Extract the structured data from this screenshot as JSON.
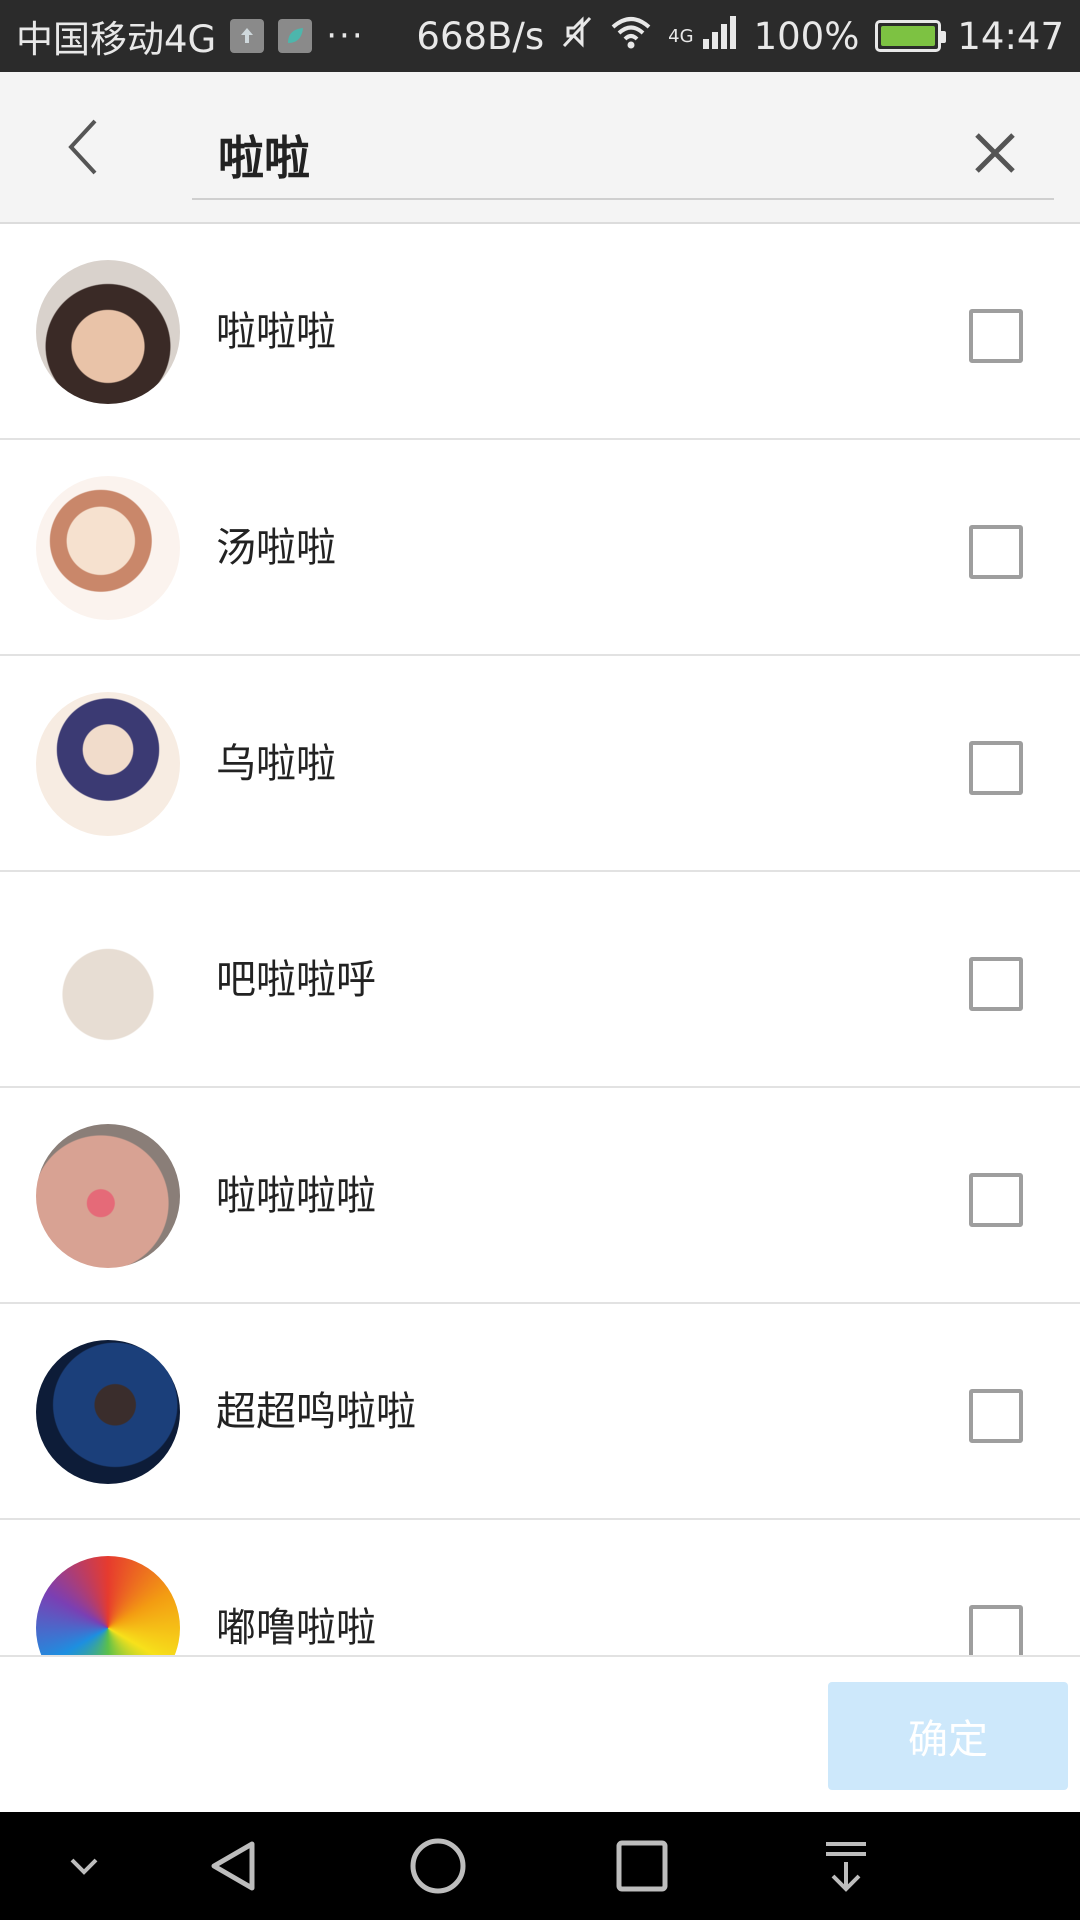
{
  "status_bar": {
    "carrier": "中国移动4G",
    "more": "···",
    "net_speed": "668B/s",
    "network_type": "4G",
    "battery": "100%",
    "time": "14:47",
    "icons": [
      "app-icon-upload",
      "app-icon-leaf",
      "mute-icon",
      "wifi-icon",
      "signal-icon",
      "battery-icon"
    ],
    "battery_color": "#7dc242"
  },
  "search": {
    "query": "啦啦",
    "back_icon": "chevron-left-icon",
    "clear_icon": "close-icon"
  },
  "contacts": [
    {
      "name": "啦啦啦",
      "checked": false
    },
    {
      "name": "汤啦啦",
      "checked": false
    },
    {
      "name": "乌啦啦",
      "checked": false
    },
    {
      "name": "吧啦啦呼",
      "checked": false
    },
    {
      "name": "啦啦啦啦",
      "checked": false
    },
    {
      "name": "超超鸣啦啦",
      "checked": false
    },
    {
      "name": "嘟噜啦啦",
      "checked": false
    }
  ],
  "actions": {
    "confirm_label": "确定",
    "confirm_color": "#cde8fb"
  },
  "nav_bar": {
    "icons": [
      "hide-keyboard-icon",
      "back-triangle-icon",
      "home-circle-icon",
      "recents-square-icon",
      "notification-pull-icon"
    ]
  }
}
